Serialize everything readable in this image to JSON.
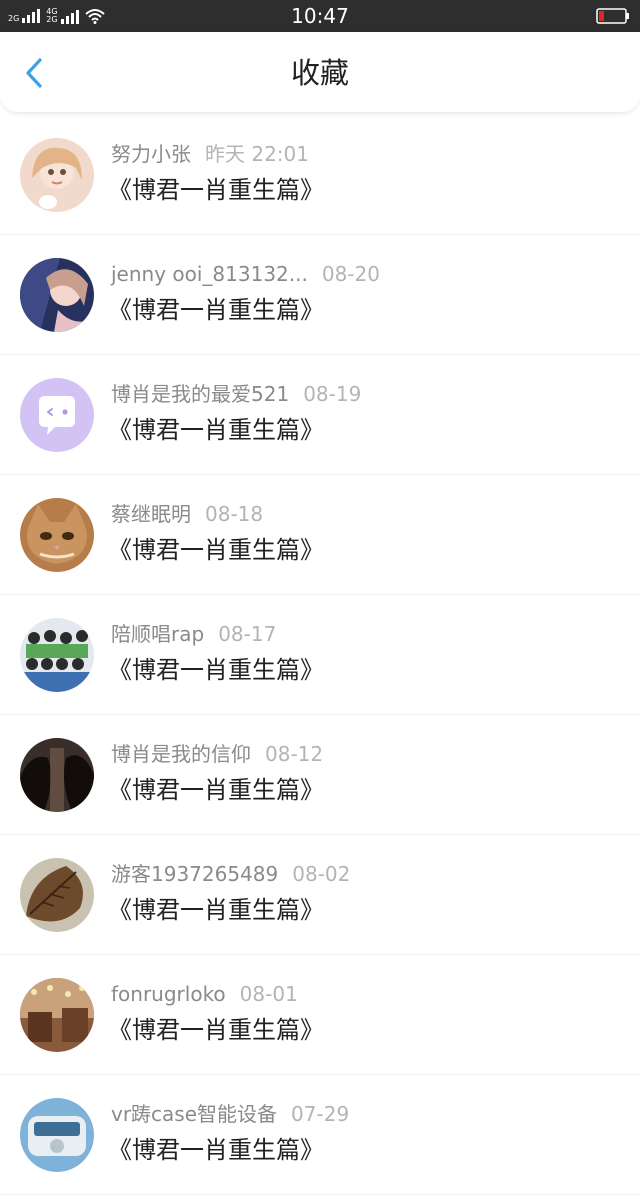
{
  "status_bar": {
    "network_1": "2G",
    "network_2a": "4G",
    "network_2b": "2G",
    "time": "10:47",
    "battery_color": "#d8262b"
  },
  "header": {
    "title": "收藏",
    "back_icon": "chevron-left-icon",
    "accent_color": "#3aa3e6"
  },
  "favorites": [
    {
      "user": "努力小张",
      "time": "昨天 22:01",
      "title": "《博君一肖重生篇》"
    },
    {
      "user": "jenny ooi_813132...",
      "time": "08-20",
      "title": "《博君一肖重生篇》"
    },
    {
      "user": "博肖是我的最爱521",
      "time": "08-19",
      "title": "《博君一肖重生篇》"
    },
    {
      "user": "蔡继眠明",
      "time": "08-18",
      "title": "《博君一肖重生篇》"
    },
    {
      "user": "陪顺唱rap",
      "time": "08-17",
      "title": "《博君一肖重生篇》"
    },
    {
      "user": "博肖是我的信仰",
      "time": "08-12",
      "title": "《博君一肖重生篇》"
    },
    {
      "user": "游客1937265489",
      "time": "08-02",
      "title": "《博君一肖重生篇》"
    },
    {
      "user": "fonrugrloko",
      "time": "08-01",
      "title": "《博君一肖重生篇》"
    },
    {
      "user": "vr踌case智能设备",
      "time": "07-29",
      "title": "《博君一肖重生篇》"
    }
  ]
}
